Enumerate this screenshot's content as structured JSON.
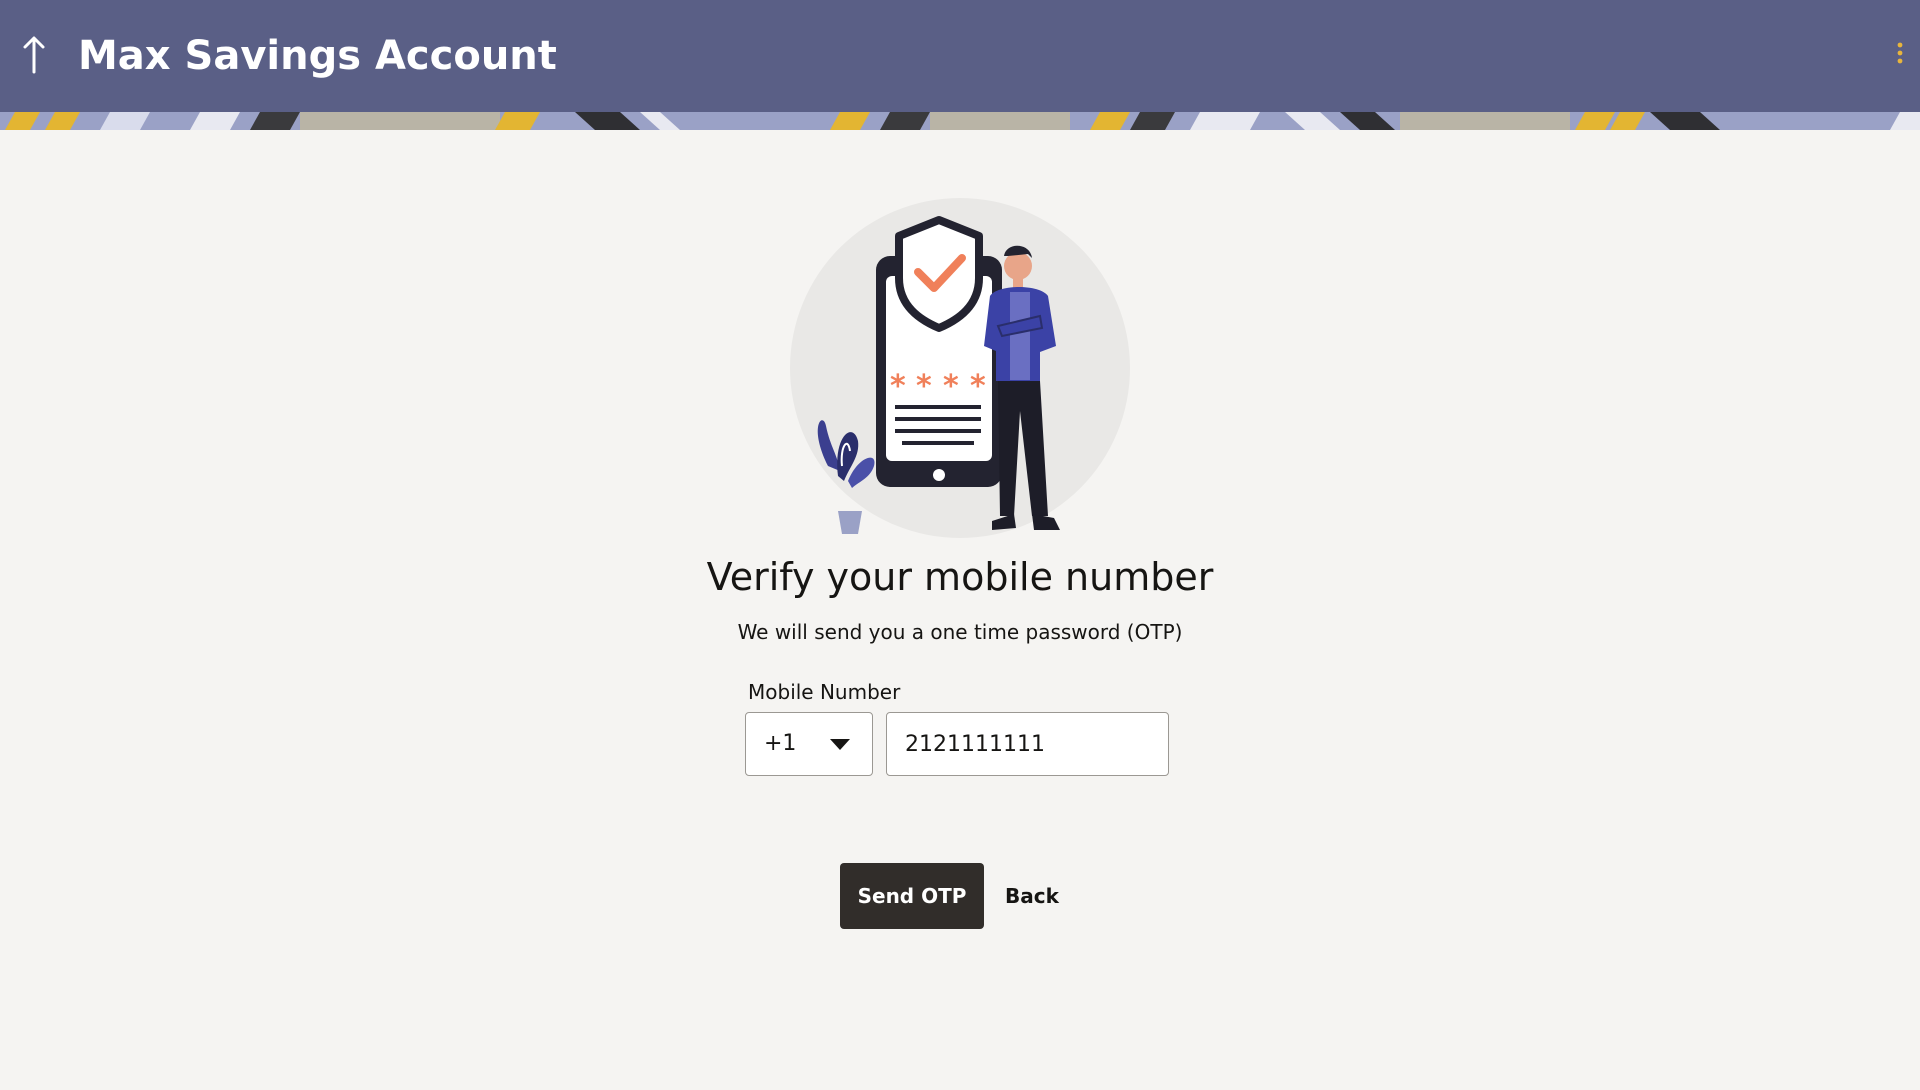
{
  "header": {
    "title": "Max Savings Account",
    "back_icon": "up-arrow-icon",
    "menu_icon": "kebab-menu-icon",
    "background_color": "#5a5f86"
  },
  "main": {
    "illustration": "mobile-verification-illustration",
    "heading": "Verify your mobile number",
    "subheading": "We will send you a one time password (OTP)",
    "mobile_label": "Mobile Number",
    "country_code": "+1",
    "mobile_value": "2121111111"
  },
  "actions": {
    "send_otp_label": "Send OTP",
    "back_label": "Back"
  },
  "colors": {
    "primary_button": "#312d2a",
    "accent": "#f0805a",
    "page_background": "#f5f4f2"
  }
}
